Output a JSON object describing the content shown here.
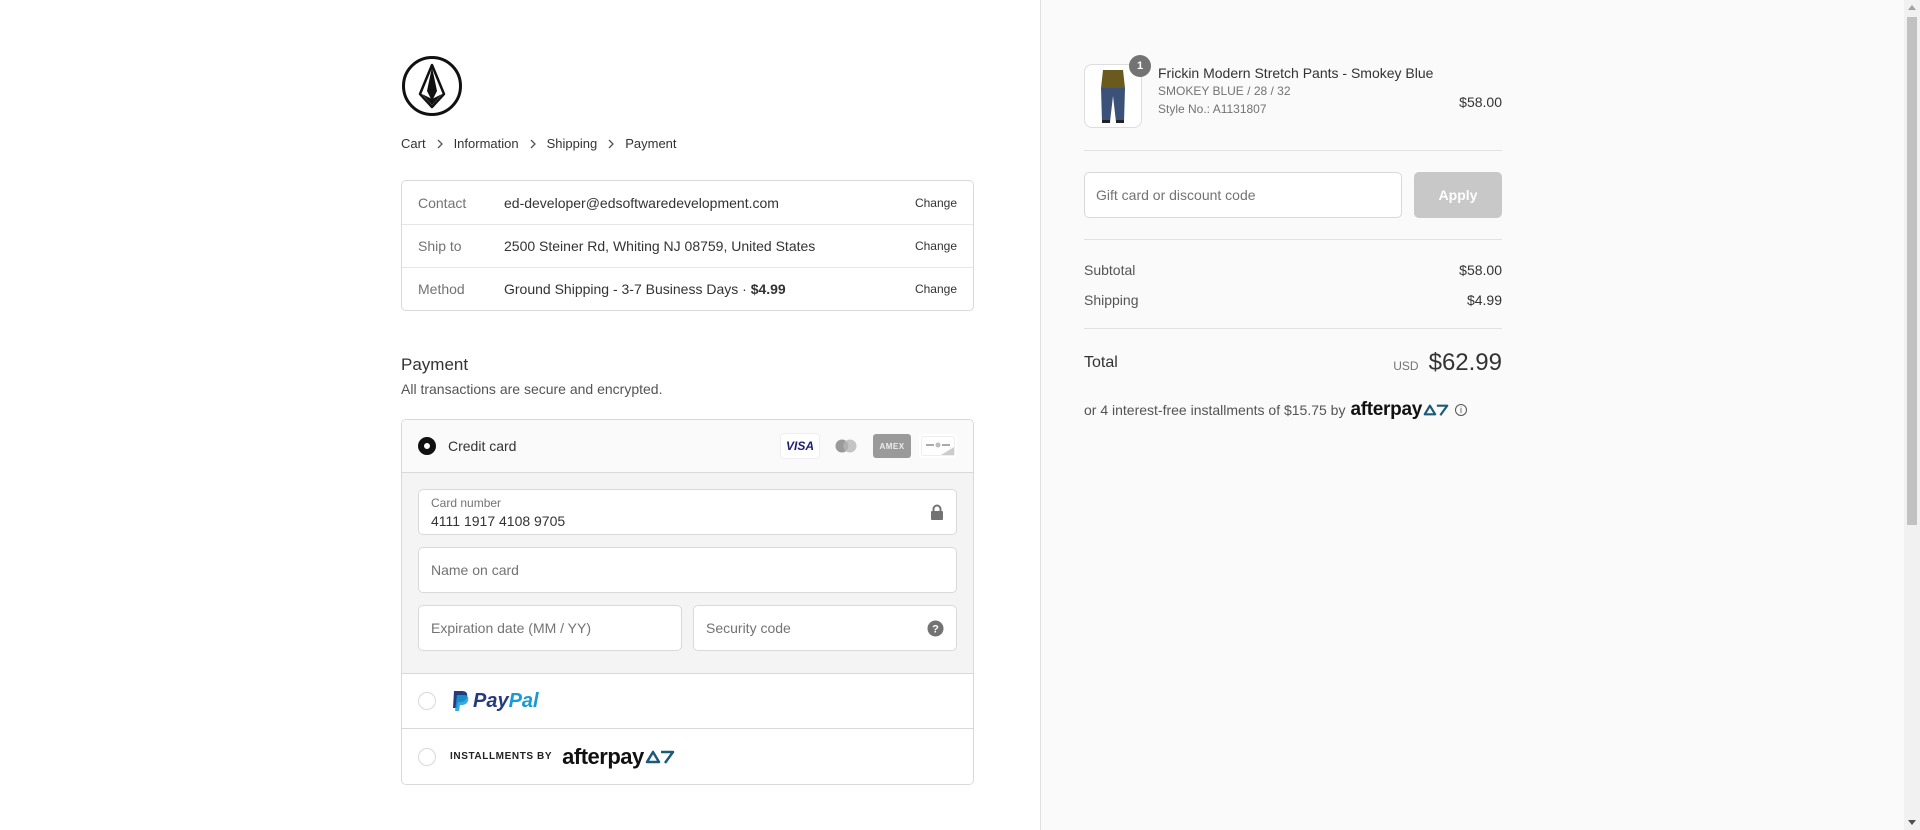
{
  "breadcrumb": [
    "Cart",
    "Information",
    "Shipping",
    "Payment"
  ],
  "review": {
    "contact": {
      "label": "Contact",
      "value": "ed-developer@edsoftwaredevelopment.com",
      "action": "Change"
    },
    "ship_to": {
      "label": "Ship to",
      "value": "2500 Steiner Rd, Whiting NJ 08759, United States",
      "action": "Change"
    },
    "method": {
      "label": "Method",
      "value": "Ground Shipping - 3-7 Business Days · ",
      "price": "$4.99",
      "action": "Change"
    }
  },
  "payment": {
    "heading": "Payment",
    "subheading": "All transactions are secure and encrypted.",
    "credit_card_label": "Credit card",
    "card_brands": [
      "VISA",
      "Mastercard",
      "AMEX",
      "Discover"
    ],
    "card_number_label": "Card number",
    "card_number_value": "4111 1917 4108 9705",
    "name_placeholder": "Name on card",
    "expiry_placeholder": "Expiration date (MM / YY)",
    "security_placeholder": "Security code",
    "paypal_label": {
      "part1": "Pay",
      "part2": "Pal"
    },
    "installments_label": "INSTALLMENTS BY",
    "afterpay_label": "afterpay"
  },
  "summary": {
    "item": {
      "quantity": "1",
      "name": "Frickin Modern Stretch Pants - Smokey Blue",
      "variant": "SMOKEY BLUE / 28 / 32",
      "style": "Style No.: A1131807",
      "price": "$58.00"
    },
    "discount_placeholder": "Gift card or discount code",
    "apply_label": "Apply",
    "subtotal_label": "Subtotal",
    "subtotal_value": "$58.00",
    "shipping_label": "Shipping",
    "shipping_value": "$4.99",
    "total_label": "Total",
    "currency": "USD",
    "total_value": "$62.99",
    "installments_text": "or 4 interest-free installments of $15.75 by",
    "afterpay_label": "afterpay"
  },
  "colors": {
    "paypal_dark": "#253b80",
    "paypal_light": "#179bd7",
    "apply_disabled": "#c8c8c8"
  }
}
